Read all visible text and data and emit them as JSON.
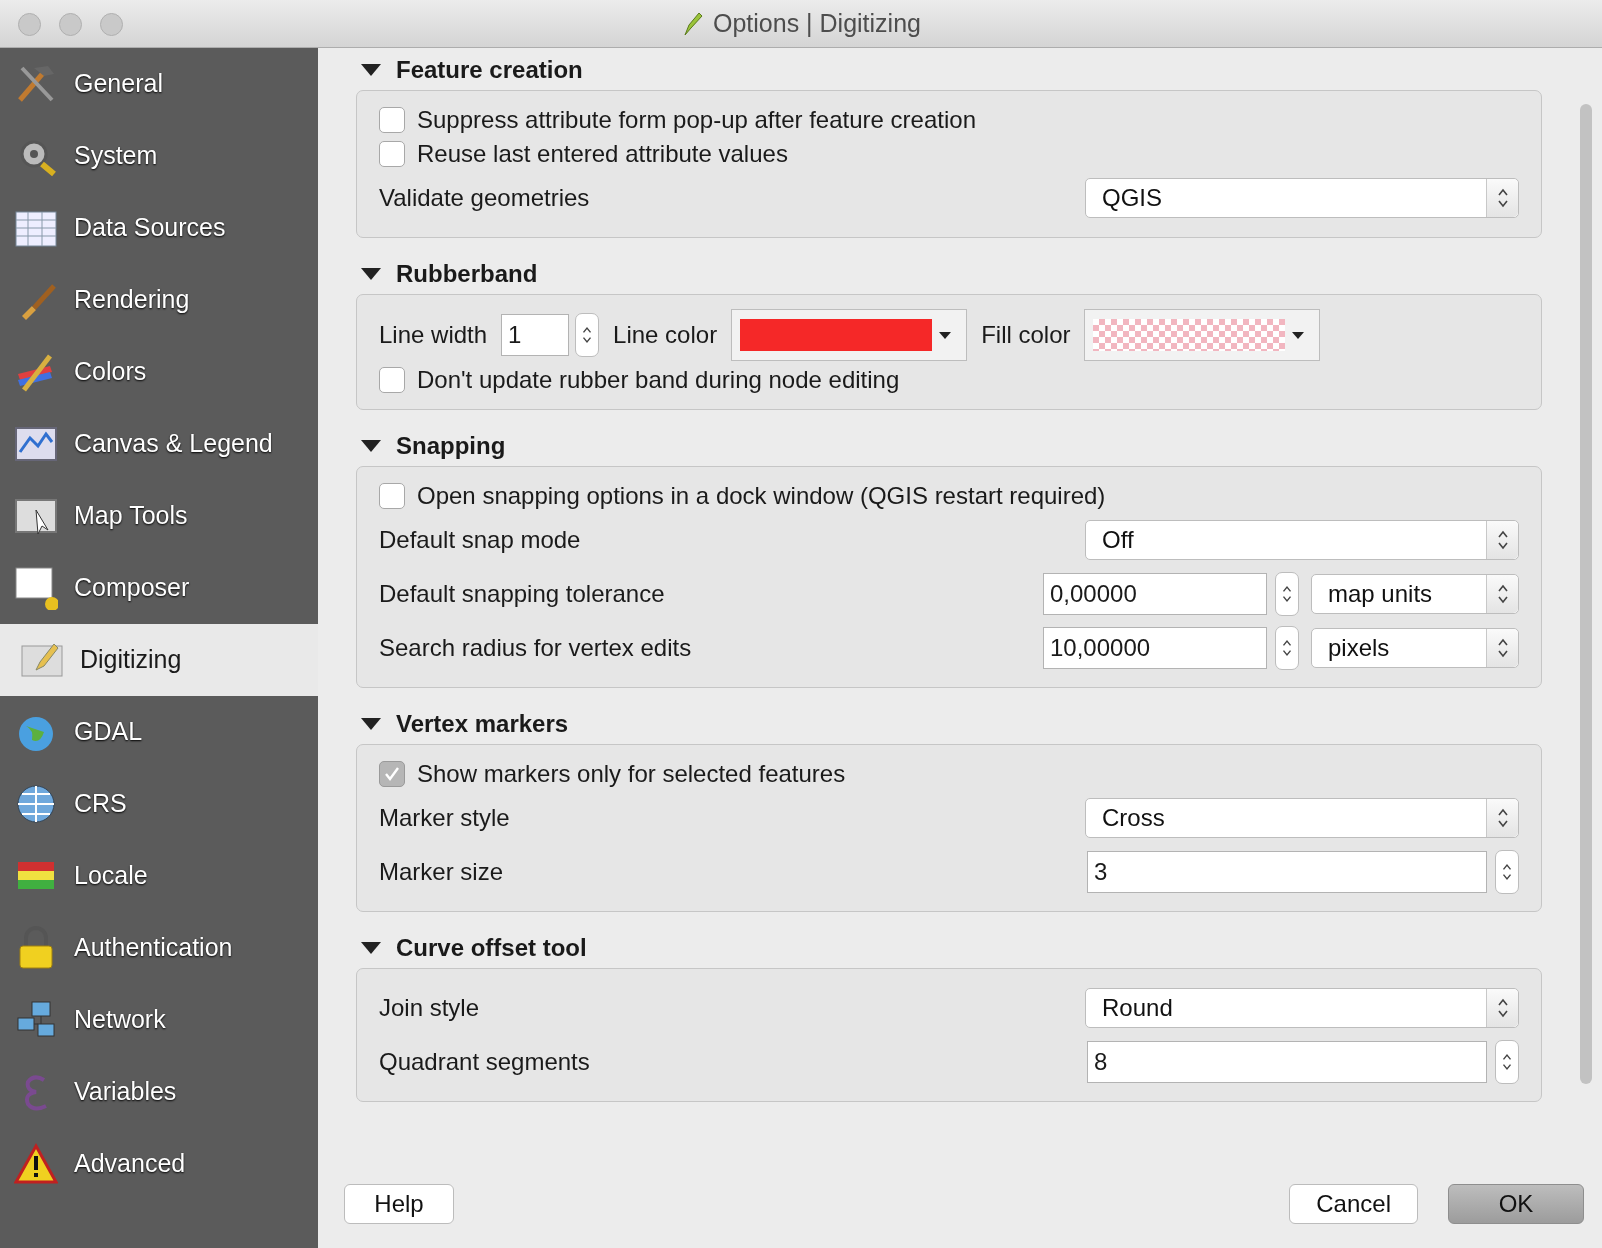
{
  "window": {
    "title": "Options | Digitizing"
  },
  "sidebar": {
    "items": [
      {
        "label": "General",
        "selected": false
      },
      {
        "label": "System",
        "selected": false
      },
      {
        "label": "Data Sources",
        "selected": false
      },
      {
        "label": "Rendering",
        "selected": false
      },
      {
        "label": "Colors",
        "selected": false
      },
      {
        "label": "Canvas & Legend",
        "selected": false
      },
      {
        "label": "Map Tools",
        "selected": false
      },
      {
        "label": "Composer",
        "selected": false
      },
      {
        "label": "Digitizing",
        "selected": true
      },
      {
        "label": "GDAL",
        "selected": false
      },
      {
        "label": "CRS",
        "selected": false
      },
      {
        "label": "Locale",
        "selected": false
      },
      {
        "label": "Authentication",
        "selected": false
      },
      {
        "label": "Network",
        "selected": false
      },
      {
        "label": "Variables",
        "selected": false
      },
      {
        "label": "Advanced",
        "selected": false
      }
    ]
  },
  "sections": [
    {
      "title": "Feature creation",
      "expanded": true,
      "rows": [
        {
          "kind": "checkbox",
          "label": "Suppress attribute form pop-up after feature creation",
          "checked": false
        },
        {
          "kind": "checkbox",
          "label": "Reuse last entered attribute values",
          "checked": false
        },
        {
          "kind": "combo",
          "label": "Validate geometries",
          "value": "QGIS"
        }
      ]
    },
    {
      "title": "Rubberband",
      "expanded": true,
      "rows": [
        {
          "kind": "rubberband",
          "width_label": "Line width",
          "width_value": "1",
          "line_label": "Line color",
          "line_color": {
            "color": "#f52828"
          },
          "fill_label": "Fill color",
          "fill_color": {
            "color": "#f2b6c0"
          }
        },
        {
          "kind": "checkbox",
          "label": "Don't update rubber band during node editing",
          "checked": false
        }
      ]
    },
    {
      "title": "Snapping",
      "expanded": true,
      "rows": [
        {
          "kind": "checkbox",
          "label": "Open snapping options in a dock window (QGIS restart required)",
          "checked": false
        },
        {
          "kind": "combo",
          "label": "Default snap mode",
          "value": "Off"
        },
        {
          "kind": "spin_combo",
          "label": "Default snapping tolerance",
          "value": "0,00000",
          "unit": "map units"
        },
        {
          "kind": "spin_combo",
          "label": "Search radius for vertex edits",
          "value": "10,00000",
          "unit": "pixels"
        }
      ]
    },
    {
      "title": "Vertex markers",
      "expanded": true,
      "rows": [
        {
          "kind": "checkbox",
          "label": "Show markers only for selected features",
          "checked": true
        },
        {
          "kind": "combo",
          "label": "Marker style",
          "value": "Cross"
        },
        {
          "kind": "spin",
          "label": "Marker size",
          "value": "3"
        }
      ]
    },
    {
      "title": "Curve offset tool",
      "expanded": true,
      "rows": [
        {
          "kind": "combo",
          "label": "Join style",
          "value": "Round"
        },
        {
          "kind": "spin",
          "label": "Quadrant segments",
          "value": "8"
        }
      ]
    }
  ],
  "buttons": [
    {
      "label": "Help",
      "default": false,
      "kind": "help"
    },
    {
      "label": "Cancel",
      "default": false,
      "kind": "action"
    },
    {
      "label": "OK",
      "default": true,
      "kind": "action"
    }
  ]
}
